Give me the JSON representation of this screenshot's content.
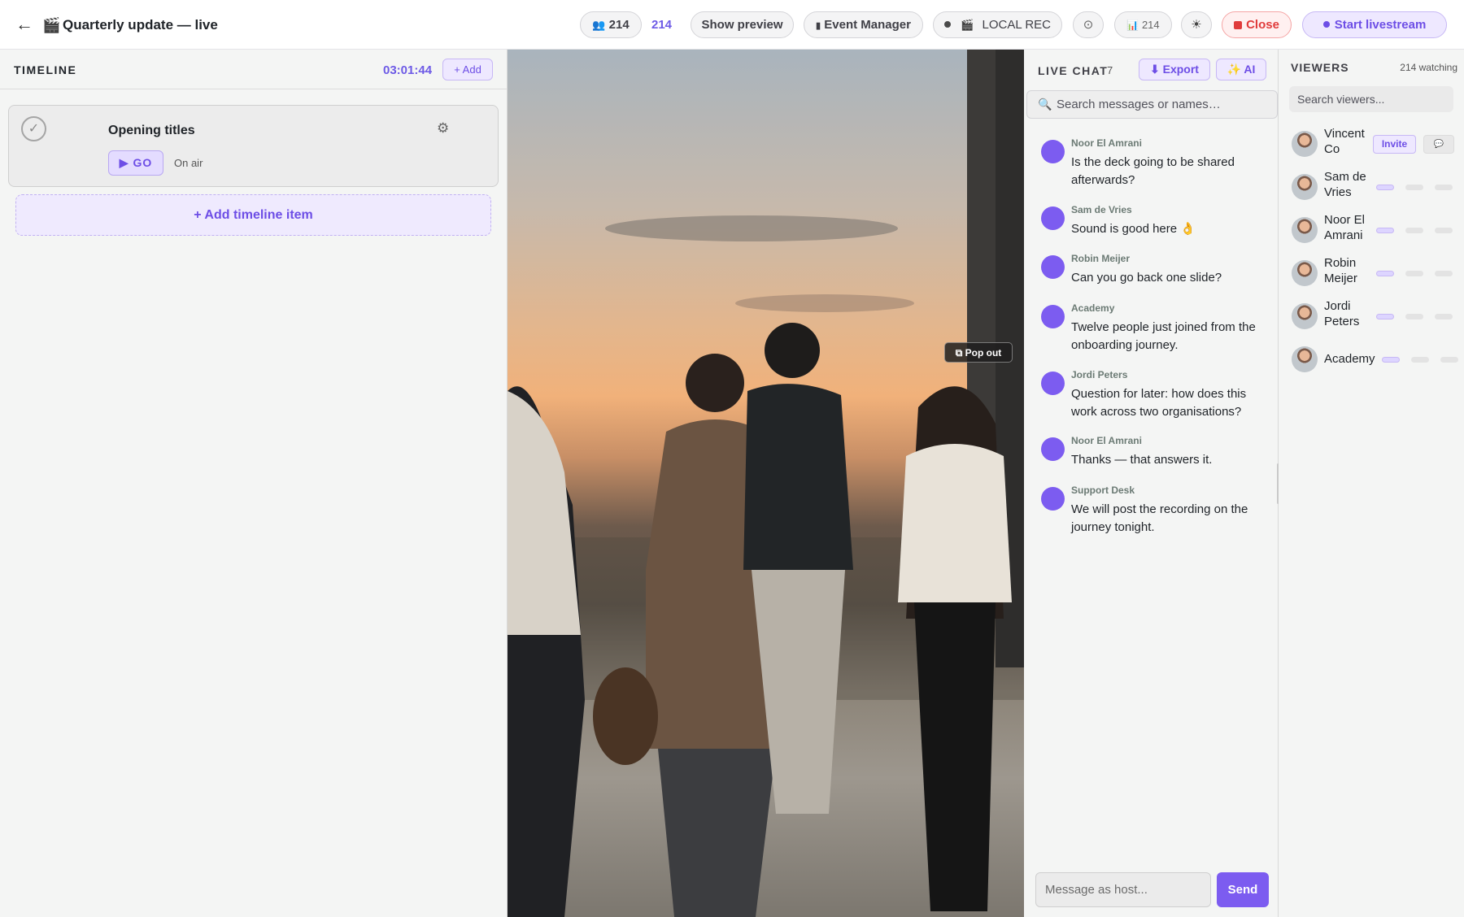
{
  "header": {
    "back_icon": "←",
    "title_icon": "🎬",
    "title": "Quarterly update — live",
    "viewers_icon": "👥",
    "viewers_count": "214",
    "viewers_count_plain": "214",
    "show_preview": "Show preview",
    "event_manager_icon": "▮",
    "event_manager": "Event Manager",
    "local_rec_icon": "🎬",
    "local_rec": "LOCAL REC",
    "settings_icon": "⊙",
    "stats_icon": "📊",
    "stats_count": "214",
    "theme_icon": "☀",
    "close": "Close",
    "start_livestream": "Start livestream"
  },
  "timeline": {
    "label": "TIMELINE",
    "clock": "03:01:44",
    "add": "+ Add",
    "items": [
      {
        "title": "Opening titles",
        "go": "▶ GO",
        "status": "On air",
        "check": "✓",
        "settings_icon": "⚙"
      }
    ],
    "add_item": "+ Add timeline item"
  },
  "video": {
    "popout": "⧉ Pop out"
  },
  "chat": {
    "label": "LIVE CHAT",
    "count": "7",
    "export": "⬇ Export",
    "ai": "✨ AI",
    "search_placeholder": "Search messages or names…",
    "messages": [
      {
        "name": "Noor El Amrani",
        "text": "Is the deck going to be shared afterwards?"
      },
      {
        "name": "Sam de Vries",
        "text": "Sound is good here 👌"
      },
      {
        "name": "Robin Meijer",
        "text": "Can you go back one slide?"
      },
      {
        "name": "Academy",
        "text": "Twelve people just joined from the onboarding journey."
      },
      {
        "name": "Jordi Peters",
        "text": "Question for later: how does this work across two organisations?"
      },
      {
        "name": "Noor El Amrani",
        "text": "Thanks — that answers it."
      },
      {
        "name": "Support Desk",
        "text": "We will post the recording on the journey tonight."
      }
    ],
    "input_placeholder": "Message as host...",
    "send": "Send"
  },
  "viewers": {
    "label": "VIEWERS",
    "watching": "214 watching",
    "search_placeholder": "Search viewers...",
    "list": [
      {
        "name": "Vincent Co",
        "invite": "Invite",
        "chip": "💬"
      },
      {
        "name": "Sam de Vries"
      },
      {
        "name": "Noor El Amrani"
      },
      {
        "name": "Robin Meijer"
      },
      {
        "name": "Jordi Peters"
      },
      {
        "name": "Academy"
      }
    ]
  },
  "colors": {
    "accent": "#6d4ee6",
    "close_red": "#e03b3b",
    "avatar_purple": "#7c5cf0"
  }
}
